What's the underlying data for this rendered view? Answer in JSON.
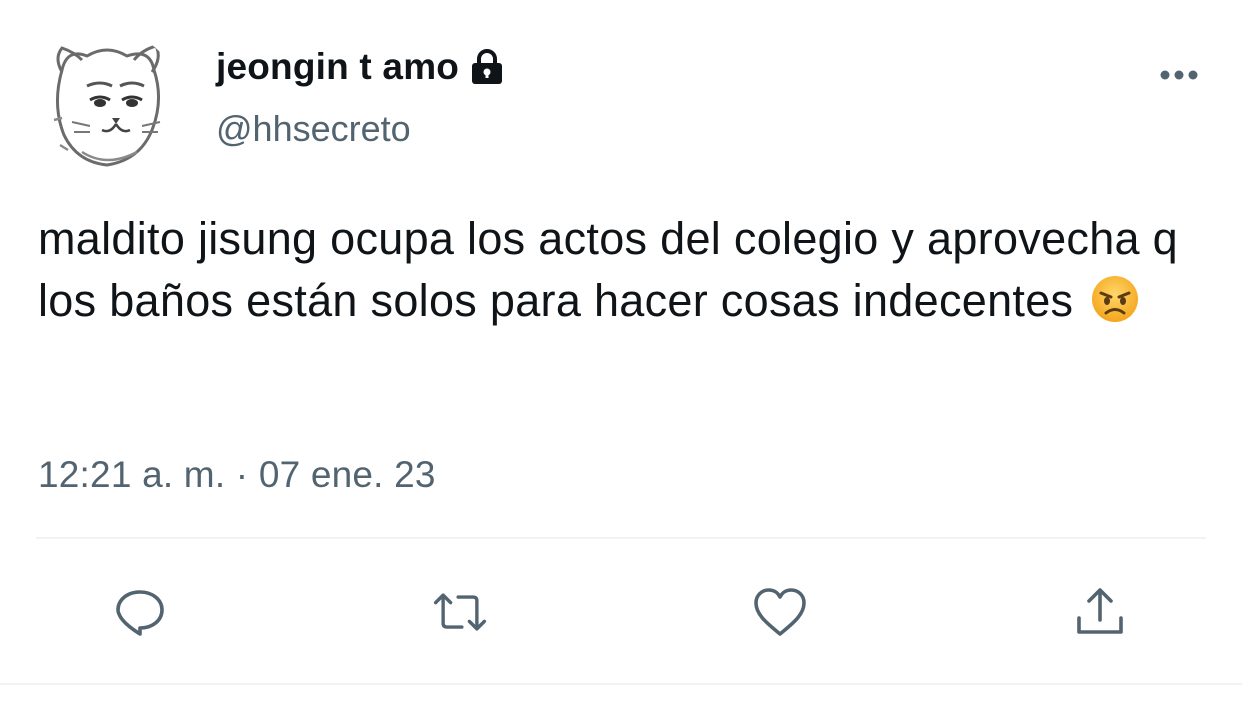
{
  "author": {
    "display_name": "jeongin t amo",
    "handle": "@hhsecreto",
    "protected": true,
    "avatar": "cartoon-cat-face-sketch"
  },
  "tweet": {
    "text": "maldito jisung ocupa los actos del colegio y aprovecha q los baños están solos para hacer cosas indecentes",
    "emoji": "angry-face-emoji",
    "time": "12:21 a. m.",
    "separator": "·",
    "date": "07 ene. 23"
  },
  "icons": {
    "more": "more-horizontal-icon",
    "lock": "lock-icon",
    "reply": "reply-icon",
    "retweet": "retweet-icon",
    "like": "heart-icon",
    "share": "share-icon"
  },
  "colors": {
    "text": "#0f1419",
    "secondary": "#536471",
    "icon": "#536471",
    "divider": "#eff3f4"
  }
}
